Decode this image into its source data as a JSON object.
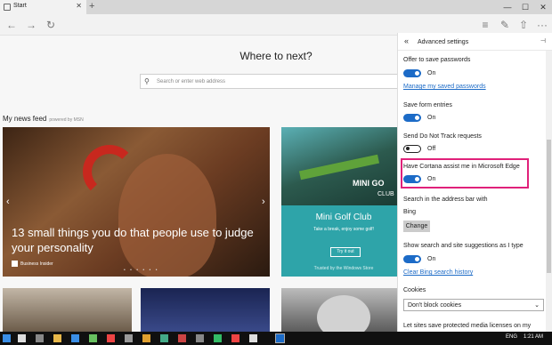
{
  "browser": {
    "tab_title": "Start",
    "tab_close": "✕",
    "new_tab": "+",
    "window_controls": [
      "—",
      "☐",
      "✕"
    ],
    "nav": {
      "back": "←",
      "forward": "→",
      "refresh": "↻"
    },
    "toolbar": {
      "hub": "≡",
      "note": "✎",
      "share": "⇧",
      "more": "···"
    }
  },
  "start": {
    "heading": "Where to next?",
    "search_placeholder": "Search or enter web address",
    "feed_title": "My news feed",
    "feed_powered": "powered by MSN",
    "featured": {
      "headline": "13 small things you do that people use to judge your personality",
      "source": "Business Insider",
      "dots": "• • • • • •",
      "prev": "‹",
      "next": "›"
    },
    "promo": {
      "logo_line1": "MINI GO",
      "logo_line2": "CLUB",
      "title": "Mini Golf Club",
      "subtitle": "Take a break, enjoy some golf!",
      "button": "Try it out",
      "footer": "Trusted by the Windows Store"
    }
  },
  "settings": {
    "title": "Advanced settings",
    "back": "«",
    "pin": "⊣",
    "items": [
      {
        "label": "Offer to save passwords",
        "state": "On"
      },
      {
        "label": "Save form entries",
        "state": "On"
      },
      {
        "label": "Send Do Not Track requests",
        "state": "Off"
      },
      {
        "label": "Have Cortana assist me in Microsoft Edge",
        "state": "On"
      },
      {
        "label": "Show search and site suggestions as I type",
        "state": "On"
      }
    ],
    "manage_passwords_link": "Manage my saved passwords",
    "search_address_label": "Search in the address bar with",
    "search_engine": "Bing",
    "change_button": "Change",
    "clear_bing_link": "Clear Bing search history",
    "cookies_label": "Cookies",
    "cookies_value": "Don't block cookies",
    "protected_media_label": "Let sites save protected media licenses on my"
  },
  "taskbar": {
    "language": "ENG",
    "time": "1:21 AM"
  },
  "colors": {
    "accent": "#1c6bc7",
    "highlight": "#e0217a",
    "taskbar": "#101010",
    "promo_bg": "#2ea4a9"
  }
}
